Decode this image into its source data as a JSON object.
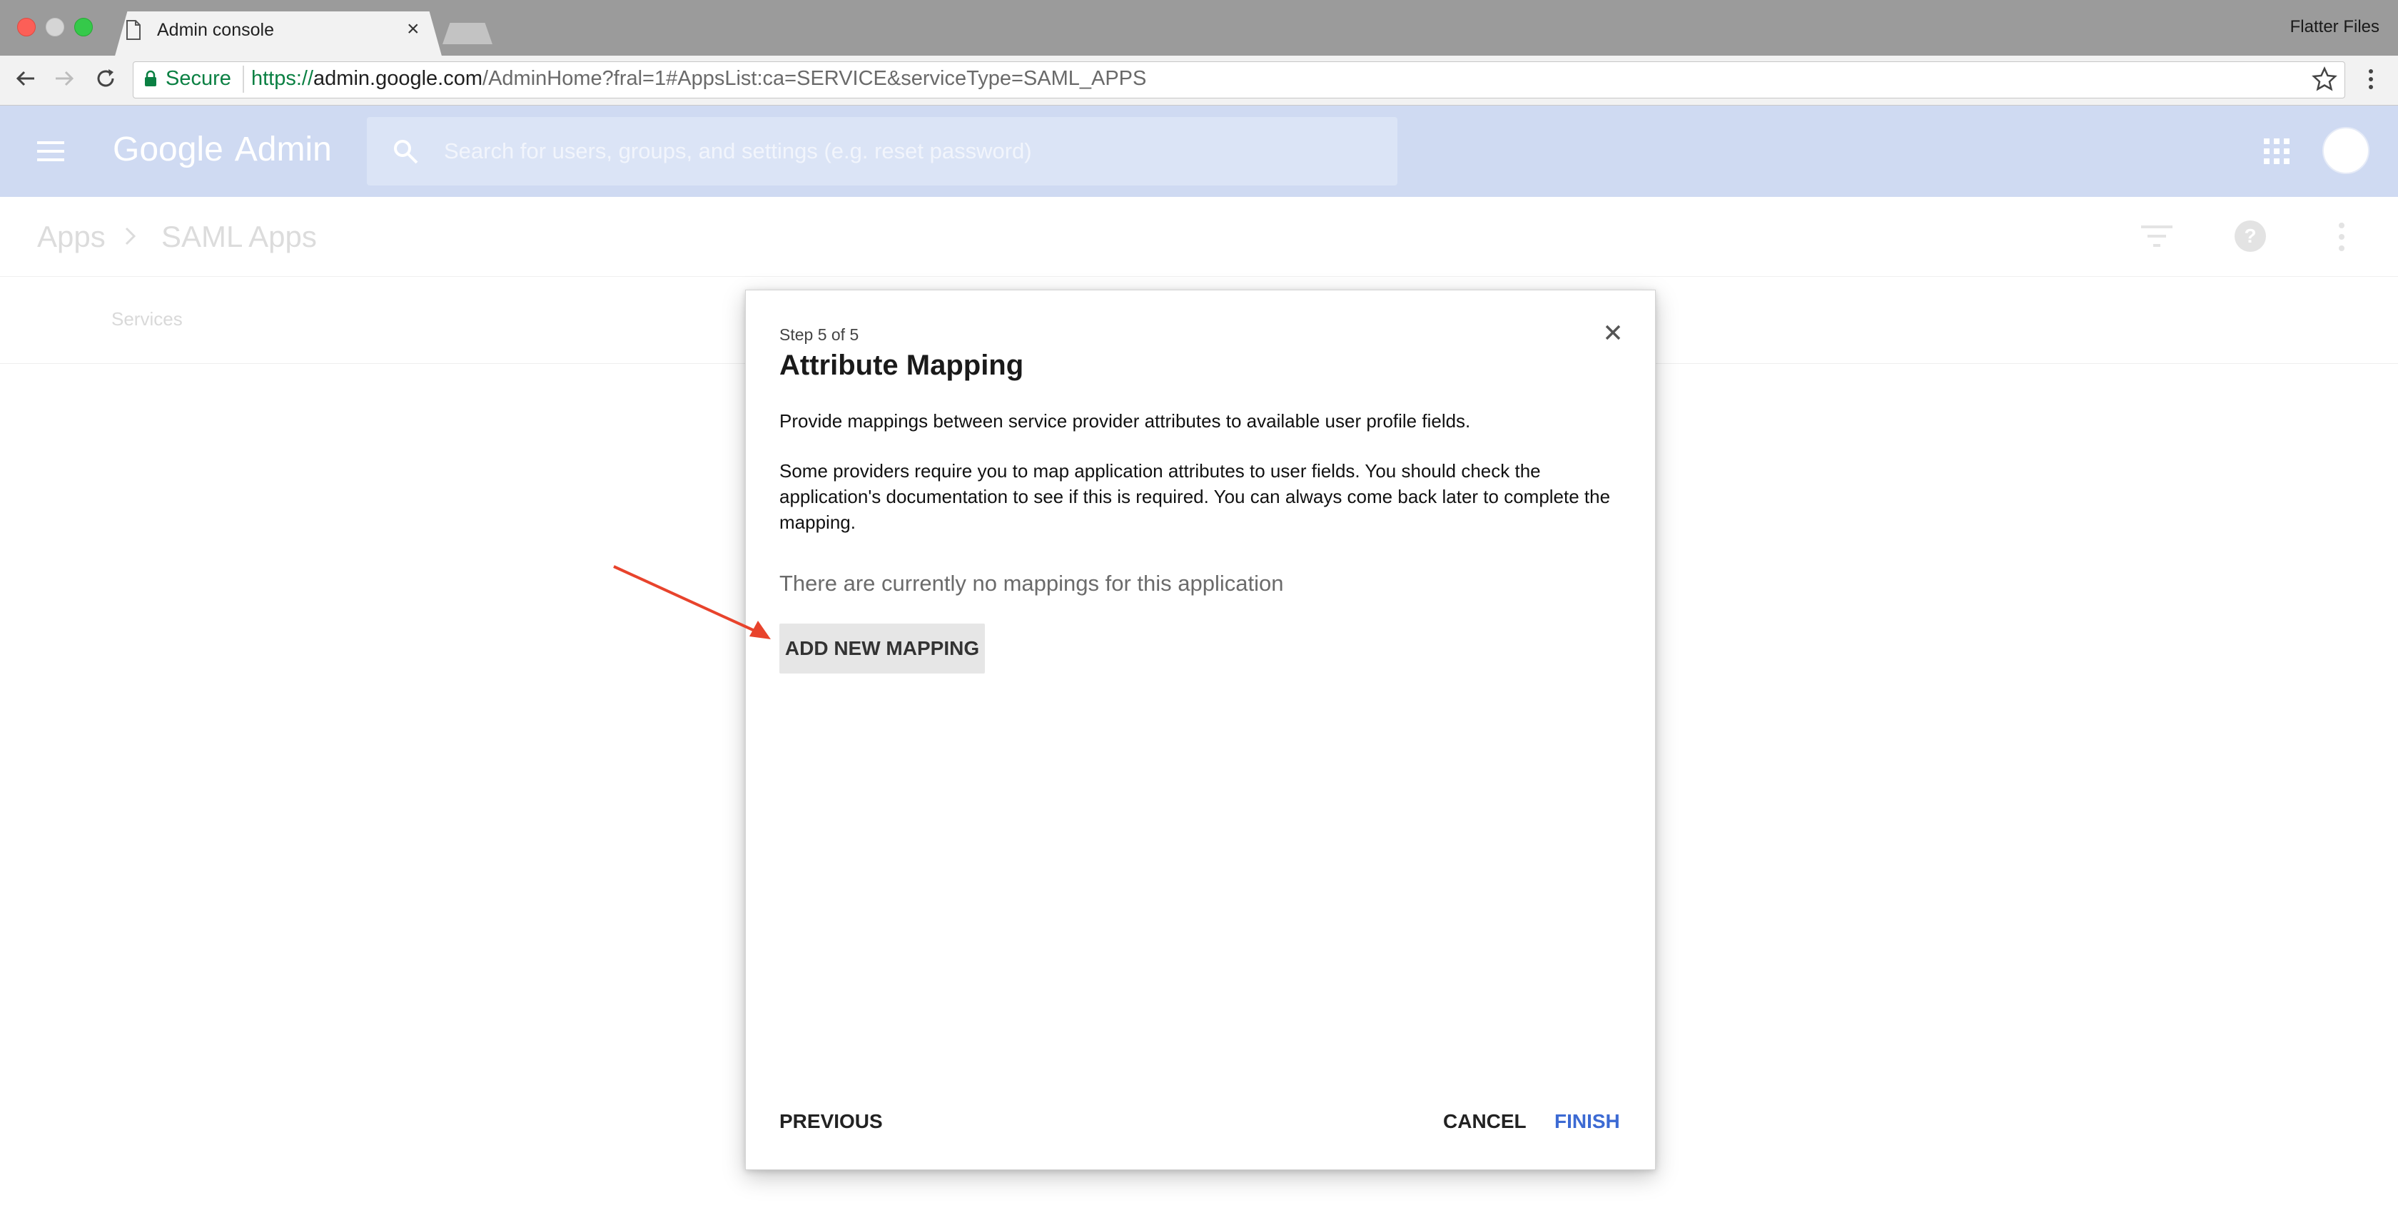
{
  "browser": {
    "tab_title": "Admin console",
    "tab_close": "×",
    "profile_name": "Flatter Files",
    "secure_label": "Secure",
    "url": {
      "scheme": "https://",
      "host": "admin.google.com",
      "path": "/AdminHome?fral=1#AppsList:ca=SERVICE&serviceType=SAML_APPS"
    }
  },
  "app": {
    "logo_google": "Google",
    "logo_admin": "Admin",
    "search_placeholder": "Search for users, groups, and settings (e.g. reset password)",
    "header_color": "#cfdaf2"
  },
  "breadcrumb": {
    "items": [
      "Apps",
      "SAML Apps"
    ]
  },
  "subnav": {
    "services_label": "Services"
  },
  "dialog": {
    "step": "Step 5 of 5",
    "title": "Attribute Mapping",
    "description": "Provide mappings between service provider attributes to available user profile fields.",
    "note": "Some providers require you to map application attributes to user fields. You should check the application's documentation to see if this is required. You can always come back later to complete the mapping.",
    "empty_state": "There are currently no mappings for this application",
    "add_button": "ADD NEW MAPPING",
    "previous_button": "PREVIOUS",
    "cancel_button": "CANCEL",
    "finish_button": "FINISH",
    "accent_color": "#3c6ad3"
  },
  "annotation": {
    "arrow_color": "#e8432c",
    "target": "add-new-mapping-button"
  }
}
